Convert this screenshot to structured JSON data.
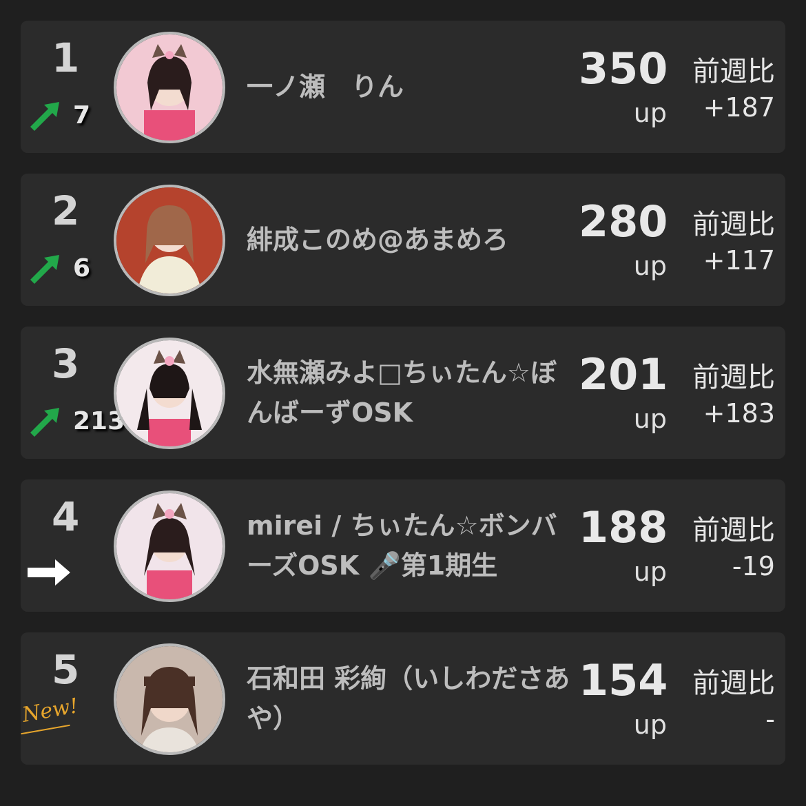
{
  "rankings": [
    {
      "rank": "1",
      "trend": "up",
      "trend_icon": "arrow-up-right-icon",
      "trend_count": "7",
      "name": "一ノ瀬　りん",
      "score": "350",
      "unit": "up",
      "compare_label": "前週比",
      "compare_value": "+187",
      "avatar_bg": "#f2c9d3"
    },
    {
      "rank": "2",
      "trend": "up",
      "trend_icon": "arrow-up-right-icon",
      "trend_count": "6",
      "name": "緋成このめ@あまめろ",
      "score": "280",
      "unit": "up",
      "compare_label": "前週比",
      "compare_value": "+117",
      "avatar_bg": "#b5432d"
    },
    {
      "rank": "3",
      "trend": "up",
      "trend_icon": "arrow-up-right-icon",
      "trend_count": "213",
      "name": "水無瀬みよ□ちぃたん☆ぼんばーずOSK",
      "score": "201",
      "unit": "up",
      "compare_label": "前週比",
      "compare_value": "+183",
      "avatar_bg": "#f3e9ec"
    },
    {
      "rank": "4",
      "trend": "same",
      "trend_icon": "arrow-right-icon",
      "trend_count": "",
      "name": "mirei / ちぃたん☆ボンバーズOSK 🎤第1期生",
      "score": "188",
      "unit": "up",
      "compare_label": "前週比",
      "compare_value": "-19",
      "avatar_bg": "#f1e4ea"
    },
    {
      "rank": "5",
      "trend": "new",
      "trend_icon": "new-badge-icon",
      "trend_count": "",
      "new_label": "New!",
      "name": "石和田 彩絢（いしわださあや）",
      "score": "154",
      "unit": "up",
      "compare_label": "前週比",
      "compare_value": "-",
      "avatar_bg": "#c9b8ad"
    }
  ],
  "colors": {
    "background": "#1f1f1f",
    "card": "#2b2b2b",
    "arrow_up": "#22a84a",
    "arrow_same": "#ffffff",
    "new_badge": "#e6a52c"
  }
}
